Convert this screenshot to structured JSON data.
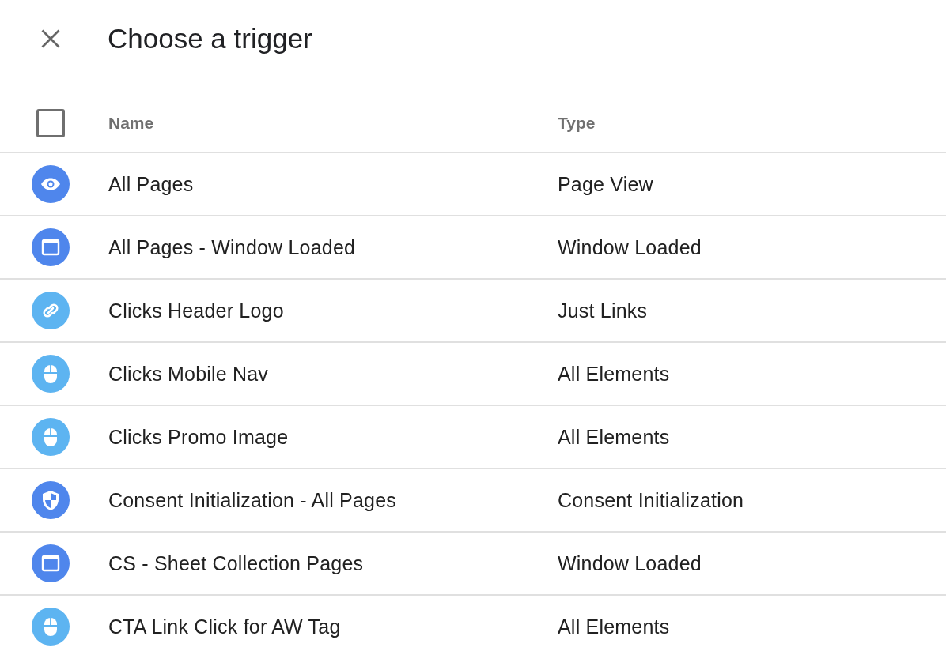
{
  "header": {
    "title": "Choose a trigger"
  },
  "table": {
    "select_all": {
      "checked": false
    },
    "columns": [
      "Name",
      "Type"
    ],
    "rows": [
      {
        "kind": "eye",
        "color": "#4f86ec",
        "name": "All Pages",
        "type": "Page View"
      },
      {
        "kind": "window",
        "color": "#4f86ec",
        "name": "All Pages - Window Loaded",
        "type": "Window Loaded"
      },
      {
        "kind": "link",
        "color": "#5db4f1",
        "name": "Clicks Header Logo",
        "type": "Just Links"
      },
      {
        "kind": "mouse",
        "color": "#5db4f1",
        "name": "Clicks Mobile Nav",
        "type": "All Elements"
      },
      {
        "kind": "mouse",
        "color": "#5db4f1",
        "name": "Clicks Promo Image",
        "type": "All Elements"
      },
      {
        "kind": "shield",
        "color": "#4f86ec",
        "name": "Consent Initialization - All Pages",
        "type": "Consent Initialization"
      },
      {
        "kind": "window",
        "color": "#4f86ec",
        "name": "CS - Sheet Collection Pages",
        "type": "Window Loaded"
      },
      {
        "kind": "mouse",
        "color": "#5db4f1",
        "name": "CTA Link Click for AW Tag",
        "type": "All Elements"
      }
    ]
  }
}
